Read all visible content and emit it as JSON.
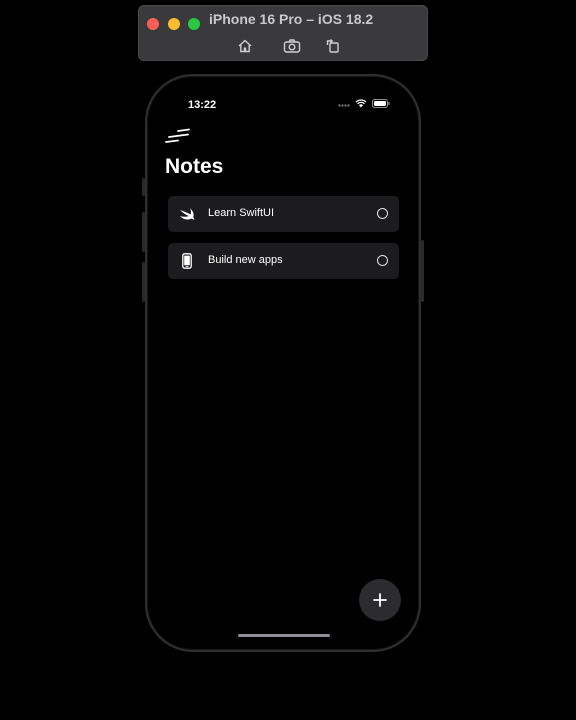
{
  "simulator": {
    "title": "iPhone 16 Pro – iOS 18.2",
    "tools": [
      {
        "icon": "home-icon"
      },
      {
        "icon": "camera-icon"
      },
      {
        "icon": "rotate-icon"
      }
    ],
    "traffic_colors": [
      "#ff5f57",
      "#febc2e",
      "#28c840"
    ]
  },
  "status_bar": {
    "time": "13:22",
    "icons": [
      "signal-dots-icon",
      "wifi-icon",
      "battery-icon"
    ]
  },
  "app": {
    "menu_icon": "menu-lines-icon",
    "title": "Notes",
    "notes": [
      {
        "label": "Learn SwiftUI",
        "icon": "swift-bird-icon",
        "done": false
      },
      {
        "label": "Build new apps",
        "icon": "iphone-icon",
        "done": false
      }
    ],
    "add_icon": "plus-icon"
  },
  "colors": {
    "background": "#000000",
    "row_background": "#1c1c1e",
    "fab_background": "#2c2c2e",
    "text": "#ffffff"
  }
}
